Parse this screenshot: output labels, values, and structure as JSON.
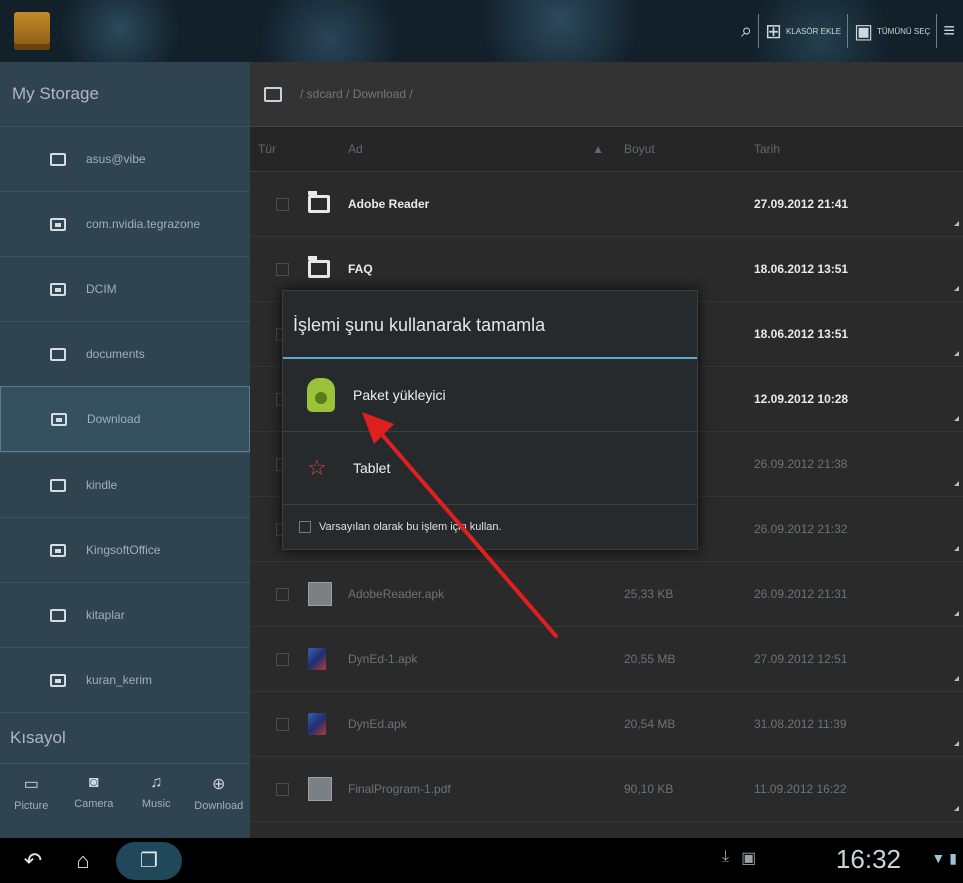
{
  "topbar": {
    "actions": [
      {
        "icon": "search-icon",
        "label": ""
      },
      {
        "icon": "add-folder-icon",
        "label": "KLASÖR EKLE"
      },
      {
        "icon": "select-all-icon",
        "label": "TÜMÜNÜ SEÇ"
      },
      {
        "icon": "menu-icon",
        "label": ""
      }
    ]
  },
  "sidebar": {
    "header": "My Storage",
    "items": [
      {
        "label": "asus@vibe",
        "selected": false
      },
      {
        "label": "com.nvidia.tegrazone",
        "selected": false
      },
      {
        "label": "DCIM",
        "selected": false
      },
      {
        "label": "documents",
        "selected": false
      },
      {
        "label": "Download",
        "selected": true
      },
      {
        "label": "kindle",
        "selected": false
      },
      {
        "label": "KingsoftOffice",
        "selected": false
      },
      {
        "label": "kitaplar",
        "selected": false
      },
      {
        "label": "kuran_kerim",
        "selected": false
      }
    ],
    "shortcut_header": "Kısayol",
    "shortcuts": [
      "Picture",
      "Camera",
      "Music",
      "Download"
    ]
  },
  "main": {
    "path": "/ sdcard / Download /",
    "columns": {
      "type": "Tür",
      "name": "Ad",
      "size": "Boyut",
      "date": "Tarih"
    },
    "rows": [
      {
        "name": "Adobe Reader",
        "size": "",
        "date": "27.09.2012 21:41"
      },
      {
        "name": "FAQ",
        "size": "",
        "date": "18.06.2012 13:51"
      },
      {
        "name": "",
        "size": "",
        "date": "18.06.2012 13:51"
      },
      {
        "name": "",
        "size": "",
        "date": "12.09.2012 10:28"
      },
      {
        "name": "",
        "size": "",
        "date": "26.09.2012 21:38"
      },
      {
        "name": "",
        "size": "",
        "date": "26.09.2012 21:32"
      },
      {
        "name": "AdobeReader.apk",
        "size": "25,33 KB",
        "date": "26.09.2012 21:31"
      },
      {
        "name": "DynEd-1.apk",
        "size": "20,55 MB",
        "date": "27.09.2012 12:51"
      },
      {
        "name": "DynEd.apk",
        "size": "20,54 MB",
        "date": "31.08.2012 11:39"
      },
      {
        "name": "FinalProgram-1.pdf",
        "size": "90,10 KB",
        "date": "11.09.2012 16:22"
      }
    ]
  },
  "dialog": {
    "title": "İşlemi şunu kullanarak tamamla",
    "options": [
      {
        "label": "Paket yükleyici",
        "icon": "android-icon"
      },
      {
        "label": "Tablet",
        "icon": "tablet-app-icon"
      }
    ],
    "default_label": "Varsayılan olarak bu işlem için kullan."
  },
  "systembar": {
    "clock": "16:32"
  },
  "colors": {
    "accent": "#5fa9c8",
    "annotation_arrow": "#e02020"
  }
}
